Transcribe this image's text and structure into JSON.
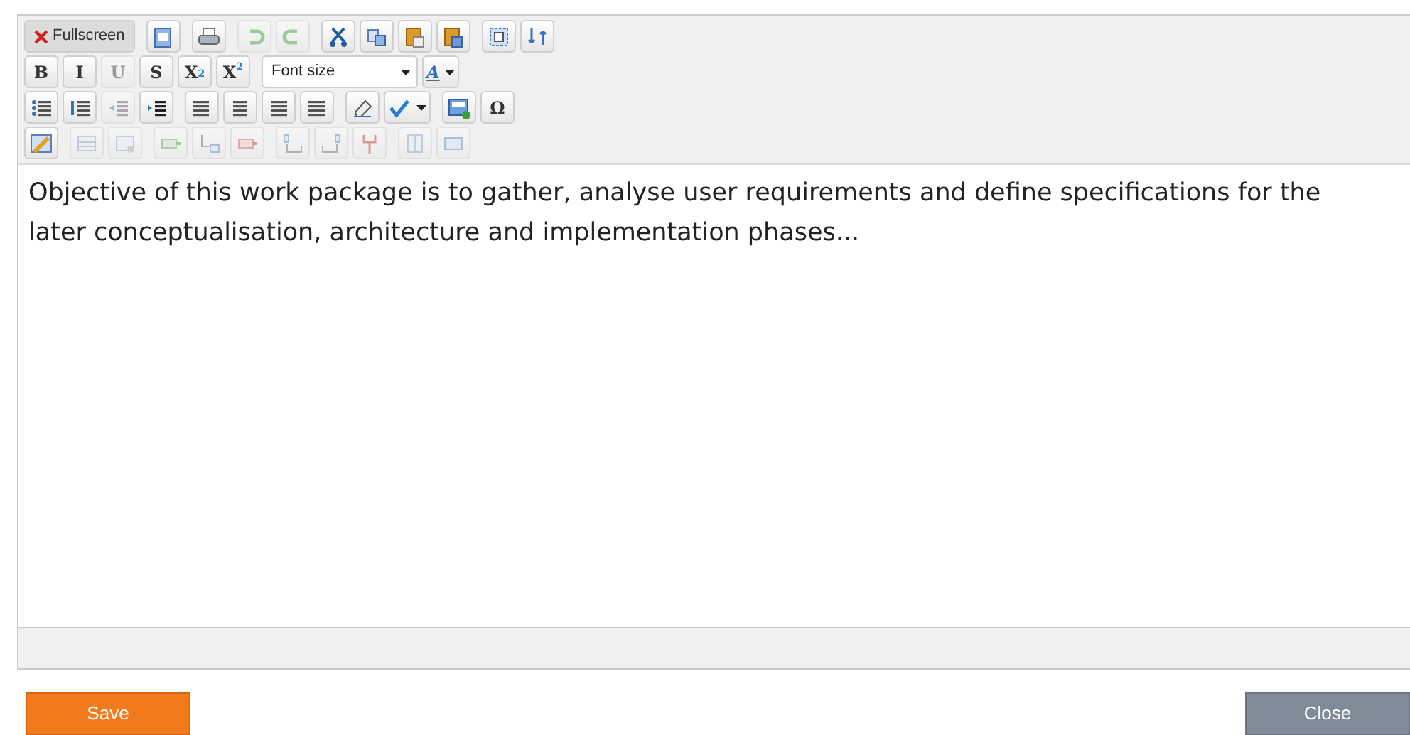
{
  "toolbar": {
    "rows": [
      [
        {
          "buttons": [
            {
              "kind": "fullscreen",
              "label": "Fullscreen",
              "disabled": false
            }
          ]
        },
        {
          "buttons": [
            {
              "kind": "paste-word",
              "disabled": false
            }
          ]
        },
        {
          "buttons": [
            {
              "kind": "print",
              "disabled": false
            }
          ]
        },
        {
          "buttons": [
            {
              "kind": "undo",
              "disabled": true
            },
            {
              "kind": "redo",
              "disabled": true
            }
          ]
        },
        {
          "buttons": [
            {
              "kind": "cut",
              "disabled": false
            },
            {
              "kind": "copy",
              "disabled": false
            },
            {
              "kind": "paste",
              "disabled": false
            },
            {
              "kind": "paste-text",
              "disabled": false
            }
          ]
        },
        {
          "buttons": [
            {
              "kind": "select-all",
              "disabled": false
            },
            {
              "kind": "replace",
              "disabled": false
            }
          ]
        }
      ],
      [
        {
          "buttons": [
            {
              "kind": "glyph",
              "label": "B",
              "disabled": false
            },
            {
              "kind": "glyph",
              "label": "I",
              "disabled": false
            },
            {
              "kind": "glyph",
              "label": "U",
              "disabled": true
            },
            {
              "kind": "glyph",
              "label": "S",
              "disabled": false
            },
            {
              "kind": "sub",
              "label": "X$_{2}$",
              "disabled": false
            },
            {
              "kind": "sup",
              "label": "X$^{2}$",
              "disabled": false
            }
          ]
        },
        {
          "buttons": [
            {
              "kind": "select",
              "label": "Font size",
              "disabled": false
            },
            {
              "kind": "font-color",
              "label": "A",
              "disabled": false
            }
          ]
        }
      ],
      [
        {
          "buttons": [
            {
              "kind": "bullets",
              "disabled": false
            },
            {
              "kind": "numbers",
              "disabled": false
            },
            {
              "kind": "outdent",
              "disabled": true
            },
            {
              "kind": "indent",
              "disabled": false
            }
          ]
        },
        {
          "buttons": [
            {
              "kind": "align-left",
              "disabled": false
            },
            {
              "kind": "align-center",
              "disabled": false
            },
            {
              "kind": "align-right",
              "disabled": false
            },
            {
              "kind": "justify",
              "disabled": false
            }
          ]
        },
        {
          "buttons": [
            {
              "kind": "eraser",
              "disabled": false
            },
            {
              "kind": "spellcheck",
              "disabled": false
            }
          ]
        },
        {
          "buttons": [
            {
              "kind": "image",
              "disabled": false
            },
            {
              "kind": "glyph",
              "label": "Ω",
              "disabled": false
            }
          ]
        }
      ],
      [
        {
          "buttons": [
            {
              "kind": "table",
              "disabled": false
            }
          ]
        },
        {
          "buttons": [
            {
              "kind": "table-props",
              "disabled": true
            },
            {
              "kind": "cell-props",
              "disabled": true
            }
          ]
        },
        {
          "buttons": [
            {
              "kind": "row-before",
              "disabled": true
            },
            {
              "kind": "row-after",
              "disabled": true
            },
            {
              "kind": "row-delete",
              "disabled": true
            }
          ]
        },
        {
          "buttons": [
            {
              "kind": "col-before",
              "disabled": true
            },
            {
              "kind": "col-after",
              "disabled": true
            },
            {
              "kind": "col-delete",
              "disabled": true
            }
          ]
        },
        {
          "buttons": [
            {
              "kind": "split",
              "disabled": true
            },
            {
              "kind": "merge",
              "disabled": true
            }
          ]
        }
      ]
    ]
  },
  "editor": {
    "text": "Objective of this work package is to gather, analyse user requirements and define specifications for the later conceptualisation, architecture and implementation phases..."
  },
  "buttons": [
    {
      "label": "Save",
      "kind": "primary"
    },
    {
      "label": "Close",
      "kind": "secondary"
    }
  ]
}
